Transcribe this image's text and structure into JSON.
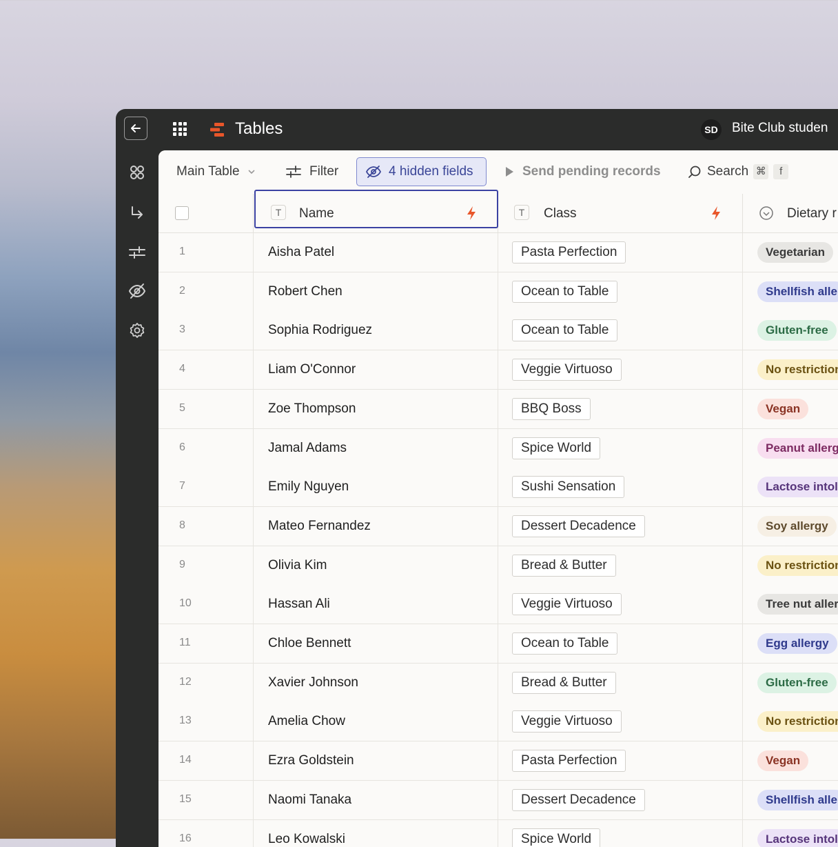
{
  "topbar": {
    "title": "Tables",
    "avatar_initials": "SD",
    "workspace": "Bite Club studen"
  },
  "toolbar": {
    "view": "Main Table",
    "filter": "Filter",
    "hidden_fields": "4 hidden fields",
    "send_pending": "Send pending records",
    "search": "Search",
    "shortcut_cmd": "⌘",
    "shortcut_key": "f"
  },
  "columns": {
    "name": "Name",
    "class": "Class",
    "dietary": "Dietary r",
    "type_badge": "T"
  },
  "colors": {
    "accent": "#e8562a",
    "selection": "#3b42a3"
  },
  "rows": [
    {
      "num": "1",
      "name": "Aisha Patel",
      "class": "Pasta Perfection",
      "diet": "Vegetarian",
      "diet_bg": "#e7e6e3",
      "diet_fg": "#3a3a3a"
    },
    {
      "num": "2",
      "name": "Robert Chen",
      "class": "Ocean to Table",
      "diet": "Shellfish alle",
      "diet_bg": "#dcdff7",
      "diet_fg": "#2f3a8c"
    },
    {
      "num": "3",
      "name": "Sophia Rodriguez",
      "class": "Ocean to Table",
      "diet": "Gluten-free",
      "diet_bg": "#dcf2e4",
      "diet_fg": "#2c6b45"
    },
    {
      "num": "4",
      "name": "Liam O'Connor",
      "class": "Veggie Virtuoso",
      "diet": "No restriction",
      "diet_bg": "#fbf0c9",
      "diet_fg": "#6b5212"
    },
    {
      "num": "5",
      "name": "Zoe Thompson",
      "class": "BBQ Boss",
      "diet": "Vegan",
      "diet_bg": "#fbe1dc",
      "diet_fg": "#8a3324"
    },
    {
      "num": "6",
      "name": "Jamal Adams",
      "class": "Spice World",
      "diet": "Peanut allerg",
      "diet_bg": "#f8def0",
      "diet_fg": "#7d2b62"
    },
    {
      "num": "7",
      "name": "Emily Nguyen",
      "class": "Sushi Sensation",
      "diet": "Lactose intol",
      "diet_bg": "#ece2f7",
      "diet_fg": "#56347a"
    },
    {
      "num": "8",
      "name": "Mateo Fernandez",
      "class": "Dessert Decadence",
      "diet": "Soy allergy",
      "diet_bg": "#f6efe4",
      "diet_fg": "#5e4a2c"
    },
    {
      "num": "9",
      "name": "Olivia Kim",
      "class": "Bread & Butter",
      "diet": "No restriction",
      "diet_bg": "#fbf0c9",
      "diet_fg": "#6b5212"
    },
    {
      "num": "10",
      "name": "Hassan Ali",
      "class": "Veggie Virtuoso",
      "diet": "Tree nut aller",
      "diet_bg": "#e7e6e3",
      "diet_fg": "#3a3a3a"
    },
    {
      "num": "11",
      "name": "Chloe Bennett",
      "class": "Ocean to Table",
      "diet": "Egg allergy",
      "diet_bg": "#dcdff7",
      "diet_fg": "#2f3a8c"
    },
    {
      "num": "12",
      "name": "Xavier Johnson",
      "class": "Bread & Butter",
      "diet": "Gluten-free",
      "diet_bg": "#dcf2e4",
      "diet_fg": "#2c6b45"
    },
    {
      "num": "13",
      "name": "Amelia Chow",
      "class": "Veggie Virtuoso",
      "diet": "No restriction",
      "diet_bg": "#fbf0c9",
      "diet_fg": "#6b5212"
    },
    {
      "num": "14",
      "name": "Ezra Goldstein",
      "class": "Pasta Perfection",
      "diet": "Vegan",
      "diet_bg": "#fbe1dc",
      "diet_fg": "#8a3324"
    },
    {
      "num": "15",
      "name": "Naomi Tanaka",
      "class": "Dessert Decadence",
      "diet": "Shellfish alle",
      "diet_bg": "#dcdff7",
      "diet_fg": "#2f3a8c"
    },
    {
      "num": "16",
      "name": "Leo Kowalski",
      "class": "Spice World",
      "diet": "Lactose intol",
      "diet_bg": "#ece2f7",
      "diet_fg": "#56347a"
    }
  ]
}
